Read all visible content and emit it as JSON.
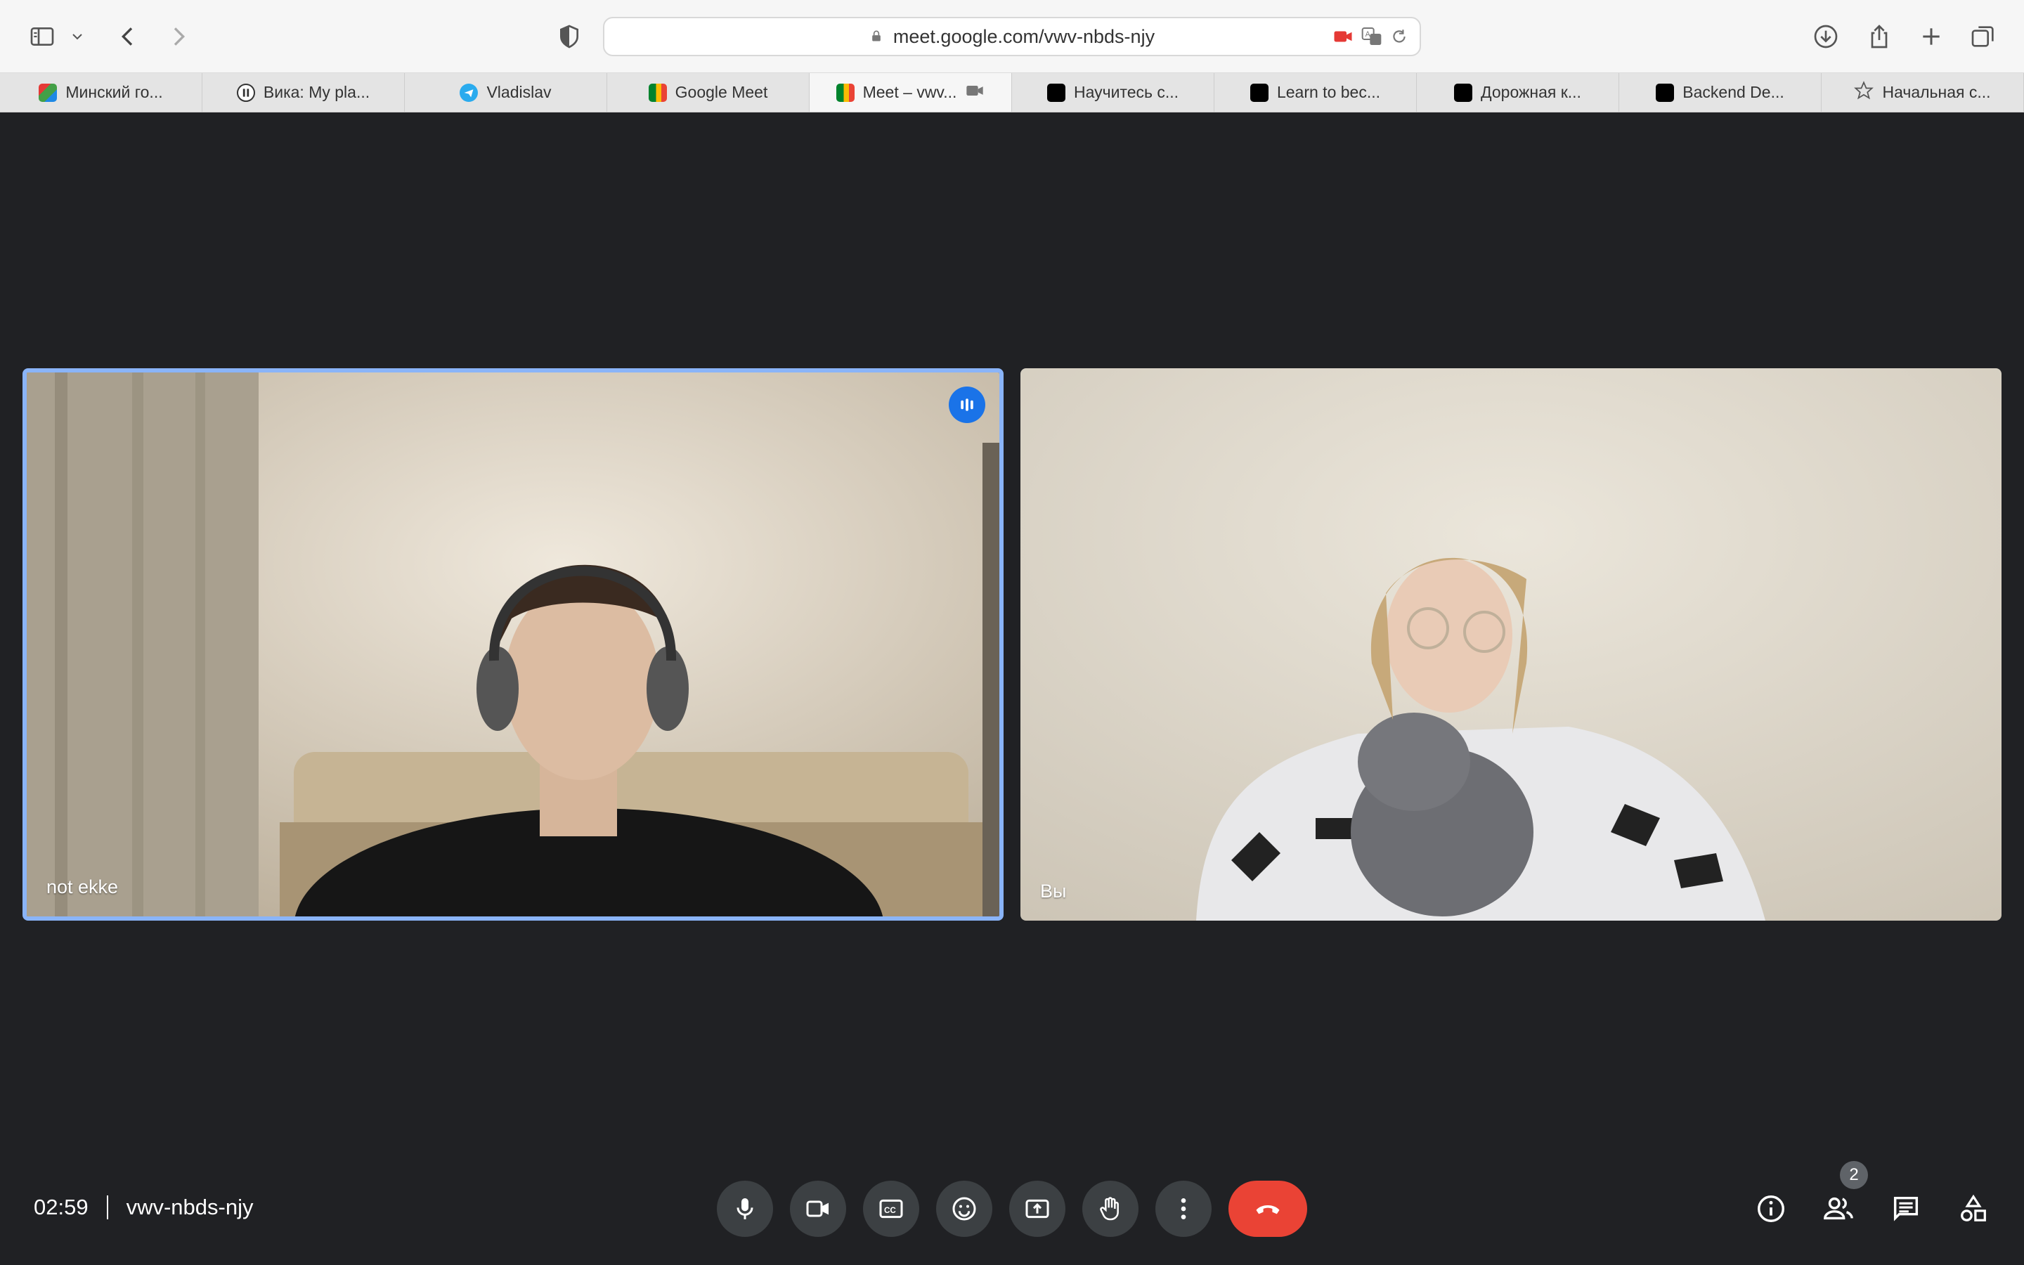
{
  "browser": {
    "url": "meet.google.com/vwv-nbds-njy",
    "tabs": [
      {
        "label": "Минский го...",
        "icon": "colorful-favicon"
      },
      {
        "label": "Вика: My pla...",
        "icon": "pause-favicon"
      },
      {
        "label": "Vladislav",
        "icon": "telegram-favicon"
      },
      {
        "label": "Google Meet",
        "icon": "meet-favicon"
      },
      {
        "label": "Meet – vwv...",
        "icon": "meet-favicon",
        "active": true
      },
      {
        "label": "Научитесь с...",
        "icon": "roadmap-favicon"
      },
      {
        "label": "Learn to bec...",
        "icon": "roadmap-favicon"
      },
      {
        "label": "Дорожная к...",
        "icon": "roadmap-favicon"
      },
      {
        "label": "Backend De...",
        "icon": "roadmap-favicon"
      },
      {
        "label": "Начальная с...",
        "icon": "star-favicon"
      }
    ]
  },
  "participants": [
    {
      "name": "not ekke",
      "speaking": true
    },
    {
      "name": "Вы",
      "speaking": false
    }
  ],
  "meeting": {
    "time": "02:59",
    "code": "vwv-nbds-njy",
    "people_count": "2"
  },
  "colors": {
    "background": "#202124",
    "control": "#3c4043",
    "hangup": "#ea4335",
    "active_border": "#8ab4f8",
    "speaking": "#1a73e8"
  }
}
